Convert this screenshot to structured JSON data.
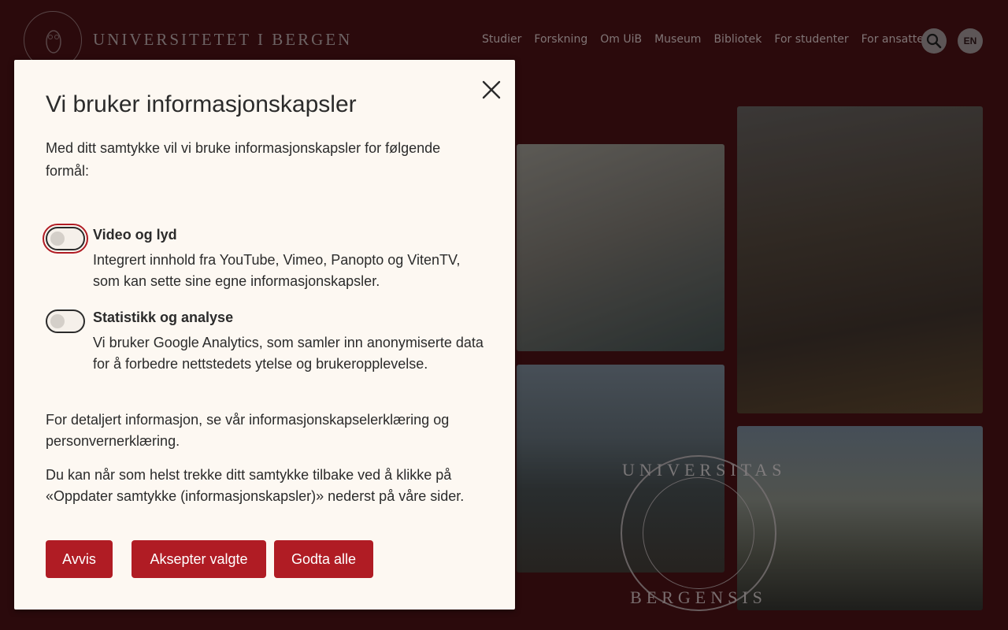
{
  "header": {
    "wordmark": "UNIVERSITETET I BERGEN",
    "nav": [
      "Studier",
      "Forskning",
      "Om UiB",
      "Museum",
      "Bibliotek",
      "For studenter",
      "For ansatte"
    ],
    "lang": "EN"
  },
  "watermark": {
    "top": "UNIVERSITAS",
    "bottom": "BERGENSIS"
  },
  "dialog": {
    "title": "Vi bruker informasjonskapsler",
    "intro": "Med ditt samtykke vil vi bruke informasjonskapsler for følgende formål:",
    "options": [
      {
        "title": "Video og lyd",
        "description": "Integrert innhold fra YouTube, Vimeo, Panopto og VitenTV, som kan sette sine egne informasjonskapsler.",
        "enabled": false
      },
      {
        "title": "Statistikk og analyse",
        "description": "Vi bruker Google Analytics, som samler inn anonymiserte data for å forbedre nettstedets ytelse og brukeropplevelse.",
        "enabled": false
      }
    ],
    "info_details": "For detaljert informasjon, se vår informasjonskapselerklæring og personvernerklæring.",
    "info_withdraw": "Du kan når som helst trekke ditt samtykke tilbake ved å klikke på «Oppdater samtykke (informasjonskapsler)» nederst på våre sider.",
    "buttons": {
      "reject": "Avvis",
      "accept_selected": "Aksepter valgte",
      "accept_all": "Godta alle"
    }
  },
  "colors": {
    "background": "#421013",
    "primary_button": "#b01c24",
    "dialog_bg": "#fdf8f2"
  }
}
